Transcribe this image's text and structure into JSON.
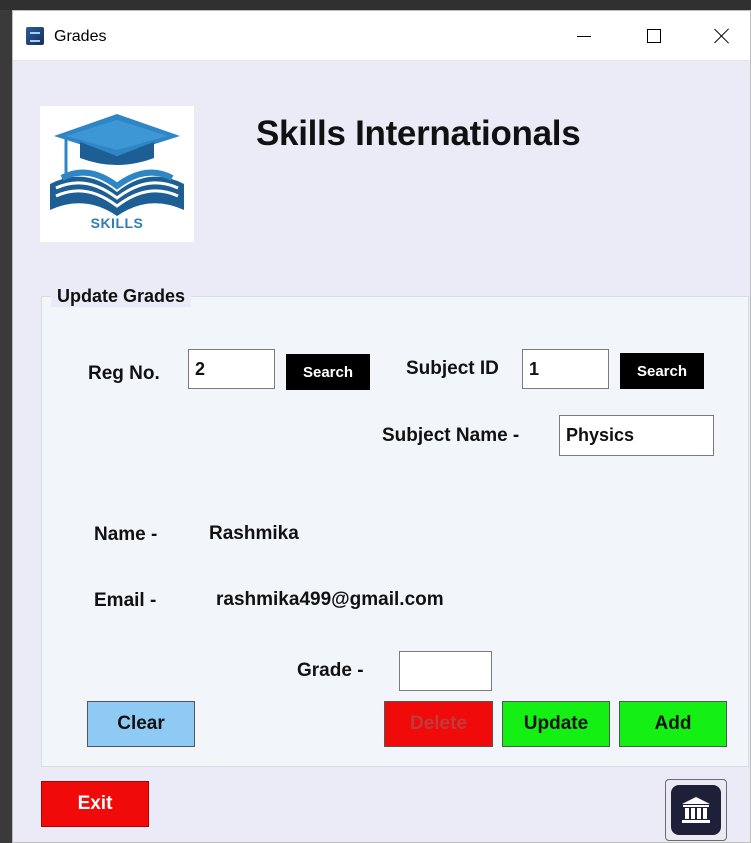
{
  "window": {
    "title": "Grades",
    "icon": "app-icon",
    "controls": [
      "minimize-icon",
      "maximize-icon",
      "close-icon"
    ]
  },
  "header": {
    "logo_text": "SKILLS",
    "app_title": "Skills Internationals"
  },
  "group": {
    "legend": "Update Grades"
  },
  "form": {
    "reg_no_label": "Reg No.",
    "reg_no_value": "2",
    "search_label_1": "Search",
    "subject_id_label": "Subject ID",
    "subject_id_value": "1",
    "search_label_2": "Search",
    "subject_name_label": "Subject Name -",
    "subject_name_value": "Physics",
    "name_label": "Name -",
    "name_value": "Rashmika",
    "email_label": "Email -",
    "email_value": "rashmika499@gmail.com",
    "grade_label": "Grade -",
    "grade_value": ""
  },
  "buttons": {
    "clear": "Clear",
    "delete": "Delete",
    "update": "Update",
    "add": "Add",
    "exit": "Exit",
    "home_icon": "bank-icon"
  },
  "colors": {
    "window_bg": "#ebebf7",
    "group_bg": "#f2f6fa",
    "clear_btn": "#8ecaf3",
    "delete_btn": "#f00a0a",
    "update_btn": "#14f014",
    "add_btn": "#14f014",
    "exit_btn": "#f00a0a",
    "search_btn": "#000000"
  }
}
